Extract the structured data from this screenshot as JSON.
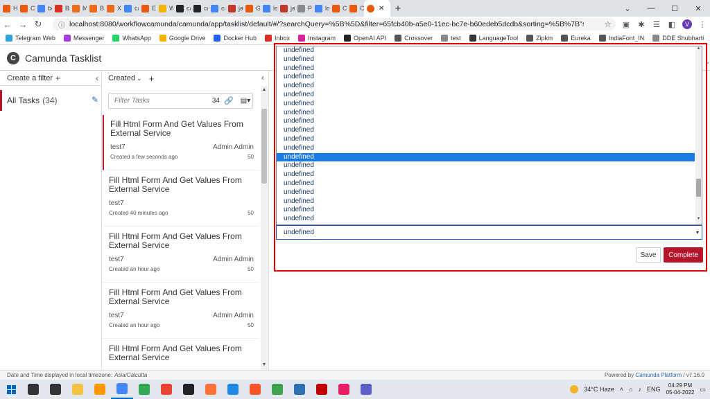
{
  "browser": {
    "tabs": [
      {
        "label": "Ho",
        "color": "#e8590c"
      },
      {
        "label": "Car",
        "color": "#e8590c"
      },
      {
        "label": "bes",
        "color": "#4285f4"
      },
      {
        "label": "Bes",
        "color": "#d93025"
      },
      {
        "label": "Mi",
        "color": "#f06a1b"
      },
      {
        "label": "Buy",
        "color": "#f06a1b"
      },
      {
        "label": "Xia",
        "color": "#f06a1b"
      },
      {
        "label": "can",
        "color": "#4285f4"
      },
      {
        "label": "Em",
        "color": "#e8590c"
      },
      {
        "label": "Wo",
        "color": "#f4b400"
      },
      {
        "label": "can",
        "color": "#222222"
      },
      {
        "label": "can",
        "color": "#222222"
      },
      {
        "label": "can",
        "color": "#4285f4"
      },
      {
        "label": "java",
        "color": "#c0392b"
      },
      {
        "label": "Get",
        "color": "#e8590c"
      },
      {
        "label": "loa",
        "color": "#4285f4"
      },
      {
        "label": "java",
        "color": "#c0392b"
      },
      {
        "label": "Pop",
        "color": "#888888"
      },
      {
        "label": "loa",
        "color": "#4285f4"
      },
      {
        "label": "Cre",
        "color": "#e8590c"
      },
      {
        "label": "Car",
        "color": "#e8590c"
      }
    ],
    "active_tab_color": "#e8590c",
    "url": "localhost:8080/workflowcamunda/camunda/app/tasklist/default/#/?searchQuery=%5B%5D&filter=65fcb40b-a5e0-11ec-bc7e-b60edeb5dcdb&sorting=%5B%7B\"sortBy\":\"created\",\"...",
    "avatar_letter": "V",
    "bookmarks": [
      {
        "label": "Telegram Web",
        "color": "#2aa3de"
      },
      {
        "label": "Messenger",
        "color": "#a23ee0"
      },
      {
        "label": "WhatsApp",
        "color": "#25d366"
      },
      {
        "label": "Google Drive",
        "color": "#f4b400"
      },
      {
        "label": "Docker Hub",
        "color": "#1d63ed"
      },
      {
        "label": "Inbox",
        "color": "#d93025"
      },
      {
        "label": "Instagram",
        "color": "#d6249f"
      },
      {
        "label": "OpenAI API",
        "color": "#222222"
      },
      {
        "label": "Crossover",
        "color": "#555555"
      },
      {
        "label": "test",
        "color": "#888888"
      },
      {
        "label": "LanguageTool",
        "color": "#333333"
      },
      {
        "label": "Zipkin",
        "color": "#555555"
      },
      {
        "label": "Eureka",
        "color": "#555555"
      },
      {
        "label": "IndiaFont_IN",
        "color": "#555555"
      },
      {
        "label": "DDE Shubharti",
        "color": "#888888"
      }
    ]
  },
  "app": {
    "title": "Camunda Tasklist",
    "logo_letter": "C",
    "accent": "#b5152b"
  },
  "filters": {
    "create_label": "Create a filter",
    "items": [
      {
        "name": "All Tasks",
        "count": "(34)"
      }
    ]
  },
  "tasklist": {
    "sort_label": "Created",
    "search_placeholder": "Filter Tasks",
    "count": "34",
    "tasks": [
      {
        "name": "Fill Html Form And Get Values From External Service",
        "process": "test7",
        "assignee": "Admin Admin",
        "created": "Created a few seconds ago",
        "priority": "50"
      },
      {
        "name": "Fill Html Form And Get Values From External Service",
        "process": "test7",
        "assignee": "",
        "created": "Created 40 minutes ago",
        "priority": "50"
      },
      {
        "name": "Fill Html Form And Get Values From External Service",
        "process": "test7",
        "assignee": "Admin Admin",
        "created": "Created an hour ago",
        "priority": "50"
      },
      {
        "name": "Fill Html Form And Get Values From External Service",
        "process": "test7",
        "assignee": "Admin Admin",
        "created": "Created an hour ago",
        "priority": "50"
      },
      {
        "name": "Fill Html Form And Get Values From External Service",
        "process": "",
        "assignee": "",
        "created": "",
        "priority": ""
      }
    ]
  },
  "form": {
    "dropdown_options": [
      "undefined",
      "undefined",
      "undefined",
      "undefined",
      "undefined",
      "undefined",
      "undefined",
      "undefined",
      "undefined",
      "undefined",
      "undefined",
      "undefined",
      "undefined",
      "undefined",
      "undefined",
      "undefined",
      "undefined",
      "undefined",
      "undefined",
      "undefined"
    ],
    "selected_index": 12,
    "select_value": "undefined",
    "save_label": "Save",
    "complete_label": "Complete"
  },
  "footer": {
    "timezone_text": "Date and Time displayed in local timezone:",
    "timezone": "Asia/Calcutta",
    "powered_prefix": "Powered by",
    "platform": "Camunda Platform",
    "version": "/ v7.16.0"
  },
  "taskbar": {
    "weather": "34°C  Haze",
    "language": "ENG",
    "time": "04:29 PM",
    "date": "05-04-2022",
    "apps": [
      {
        "name": "search-icon",
        "color": "#333333"
      },
      {
        "name": "task-view-icon",
        "color": "#333333"
      },
      {
        "name": "file-explorer-icon",
        "color": "#f5c242"
      },
      {
        "name": "sublime-icon",
        "color": "#ff9800"
      },
      {
        "name": "chrome-icon",
        "color": "#4285f4"
      },
      {
        "name": "chrome-2-icon",
        "color": "#34a853"
      },
      {
        "name": "chrome-3-icon",
        "color": "#ea4335"
      },
      {
        "name": "terminal-icon",
        "color": "#222222"
      },
      {
        "name": "firefox-icon",
        "color": "#ff7139"
      },
      {
        "name": "vscode-icon",
        "color": "#1e88e5"
      },
      {
        "name": "brave-icon",
        "color": "#fb542b"
      },
      {
        "name": "notepad-icon",
        "color": "#3fa34d"
      },
      {
        "name": "remote-desktop-icon",
        "color": "#2f6fb6"
      },
      {
        "name": "filezilla-icon",
        "color": "#bf0000"
      },
      {
        "name": "intellij-icon",
        "color": "#e91e63"
      },
      {
        "name": "teams-icon",
        "color": "#5b5fc7"
      }
    ]
  }
}
